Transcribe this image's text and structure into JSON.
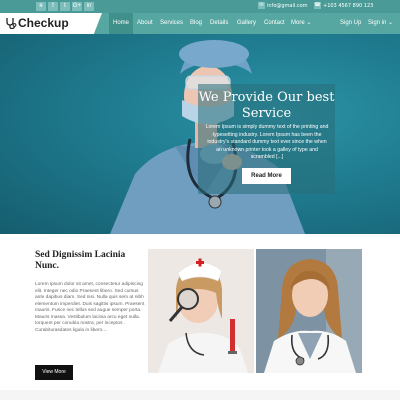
{
  "topbar": {
    "social": [
      {
        "icon": "rss-icon",
        "glyph": "ʀ"
      },
      {
        "icon": "facebook-icon",
        "glyph": "f"
      },
      {
        "icon": "twitter-icon",
        "glyph": "t"
      },
      {
        "icon": "google-plus-icon",
        "glyph": "G+"
      },
      {
        "icon": "linkedin-icon",
        "glyph": "in"
      }
    ],
    "email": "info@gmail.com",
    "phone": "+103 4567 890 123"
  },
  "header": {
    "logo": "Checkup",
    "nav": [
      {
        "label": "Home",
        "active": true
      },
      {
        "label": "About"
      },
      {
        "label": "Services"
      },
      {
        "label": "Blog"
      },
      {
        "label": "Details"
      },
      {
        "label": "Gallery"
      },
      {
        "label": "Contact"
      },
      {
        "label": "More ⌄"
      }
    ],
    "signup": "Sign Up",
    "signin": "Sign in ⌄"
  },
  "hero": {
    "title": "We Provide Our best Service",
    "text": "Lorem Ipsum is simply dummy text of the printing and typesetting industry. Lorem Ipsum has been the industry's standard dummy text ever since the when an unknown printer took a galley of type and scrambled [...]",
    "button": "Read More"
  },
  "section": {
    "title": "Sed Dignissim Lacinia Nunc.",
    "text": "Lorem ipsum dolor sit amet, consectetur adipiscing elit. Integer nec odio Praesent libero. Sed cursus ante dapibus diam. Sed nisi. Nulla quis sem at nibh elementum imperdiet. Duis sagittis ipsum. Praesent mauris. Fusce nec tellus sed augue semper porta. Mauris massa. Vestibulum lacinia arcu eget nulla. torquent per conubia nostra, per inceptos . Curabiturasdates ligula in libero....",
    "button": "View More"
  },
  "colors": {
    "topbar": "#4a9a97",
    "nav": "#56a6a1",
    "nav_active": "#3f8f8b",
    "hero": "#1f7b8f"
  }
}
